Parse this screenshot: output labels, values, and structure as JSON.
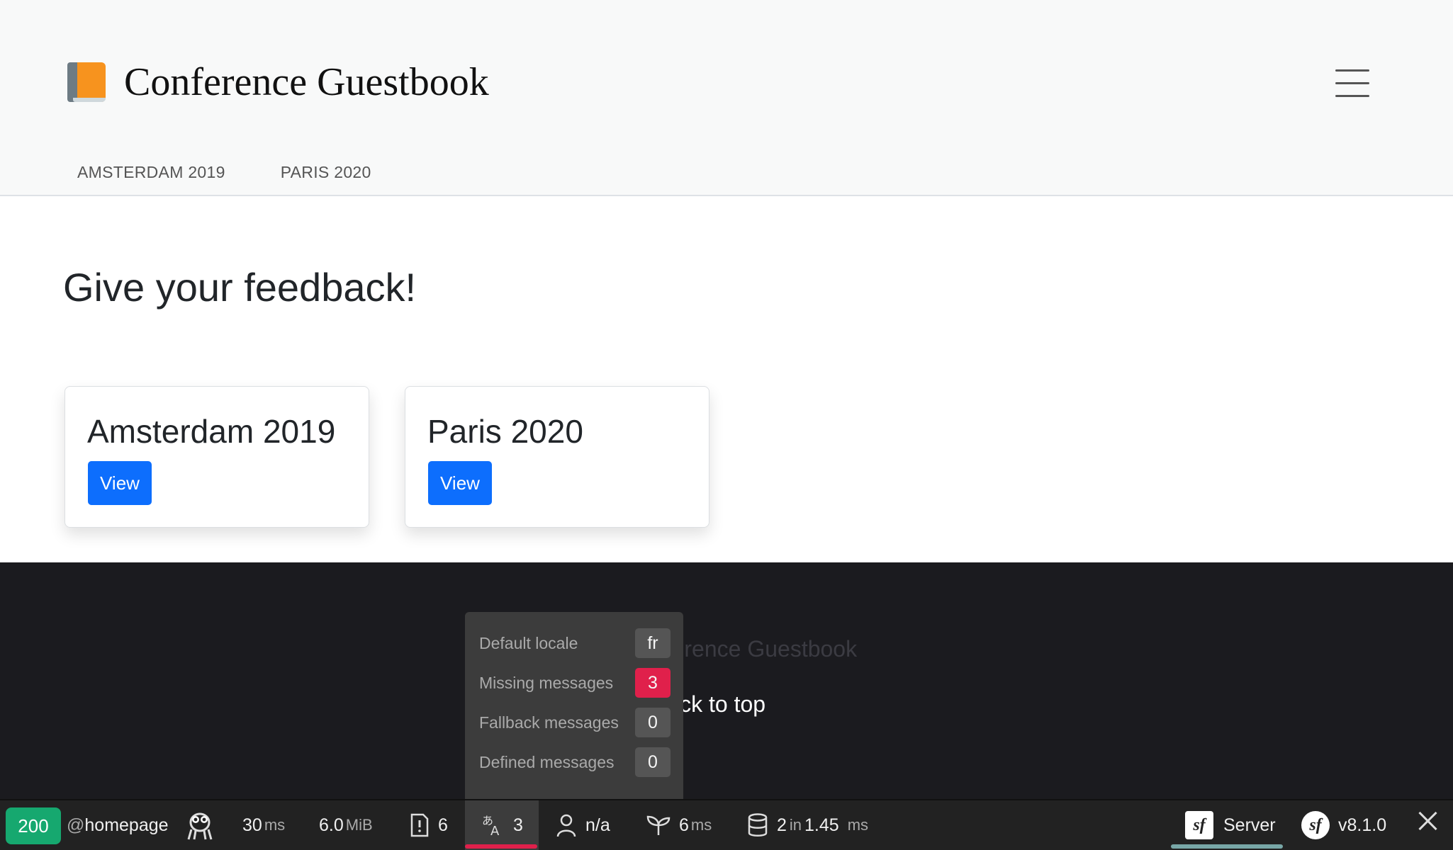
{
  "header": {
    "brand_icon": "book-icon",
    "brand": "Conference Guestbook",
    "menu_icon": "hamburger-menu-icon",
    "nav": [
      {
        "label": "AMSTERDAM 2019"
      },
      {
        "label": "PARIS 2020"
      }
    ]
  },
  "main": {
    "title": "Give your feedback!",
    "cards": [
      {
        "title": "Amsterdam 2019",
        "button": "View"
      },
      {
        "title": "Paris 2020",
        "button": "View"
      }
    ]
  },
  "footer": {
    "brand": "Conference Guestbook",
    "back_to_top": "Back to top"
  },
  "tooltip": {
    "rows": [
      {
        "label": "Default locale",
        "value": "fr"
      },
      {
        "label": "Missing messages",
        "value": "3"
      },
      {
        "label": "Fallback messages",
        "value": "0"
      },
      {
        "label": "Defined messages",
        "value": "0"
      }
    ]
  },
  "toolbar": {
    "status": "200",
    "route_prefix": "@",
    "route": "homepage",
    "ghost_icon": "ghost-icon",
    "time_value": "30",
    "time_unit": "ms",
    "memory_value": "6.0",
    "memory_unit": "MiB",
    "logs_icon": "log-file-icon",
    "logs_count": "6",
    "translation_icon": "translation-icon",
    "translation_count": "3",
    "user_icon": "user-icon",
    "user": "n/a",
    "twig_icon": "leaf-icon",
    "twig_value": "6",
    "twig_unit": "ms",
    "db_icon": "database-icon",
    "db_queries": "2",
    "db_in": "in",
    "db_time": "1.45",
    "db_unit": "ms",
    "server_label": "Server",
    "version": "v8.1.0",
    "accent_red": "#e0204b",
    "accent_green": "#16a86f"
  }
}
